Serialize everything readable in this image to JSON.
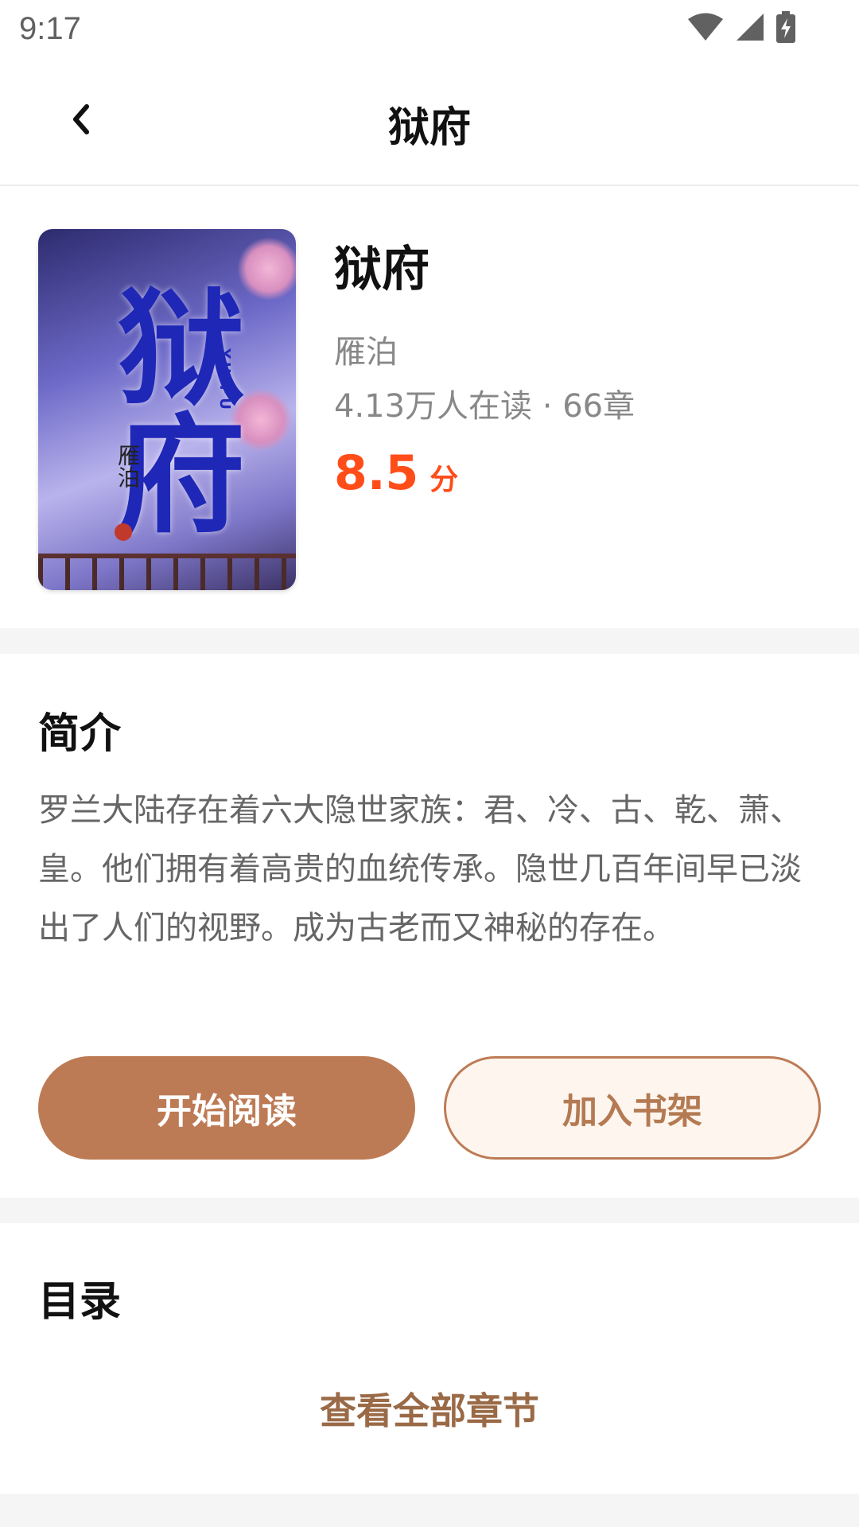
{
  "status_bar": {
    "time": "9:17",
    "icons": [
      "wifi-icon",
      "cellular-signal-icon",
      "battery-charging-icon"
    ]
  },
  "header": {
    "title": "狱府",
    "back_icon": "chevron-left-icon"
  },
  "book": {
    "title": "狱府",
    "author": "雁泊",
    "stats": "4.13万人在读 · 66章",
    "rating_value": "8.5",
    "rating_unit": "分",
    "cover": {
      "title_line1": "狱",
      "title_line2": "府",
      "subtitle": "YU FU",
      "author": "雁泊",
      "seal": "著"
    }
  },
  "intro": {
    "heading": "简介",
    "text": "罗兰大陆存在着六大隐世家族：君、冷、古、乾、萧、皇。他们拥有着高贵的血统传承。隐世几百年间早已淡出了人们的视野。成为古老而又神秘的存在。",
    "start_button": "开始阅读",
    "shelf_button": "加入书架"
  },
  "catalog": {
    "heading": "目录",
    "view_all": "查看全部章节"
  },
  "colors": {
    "accent": "#bd7b55",
    "rating": "#ff4d1a",
    "shelf_bg": "#fdf5ee",
    "page_bg": "#f5f5f5"
  }
}
